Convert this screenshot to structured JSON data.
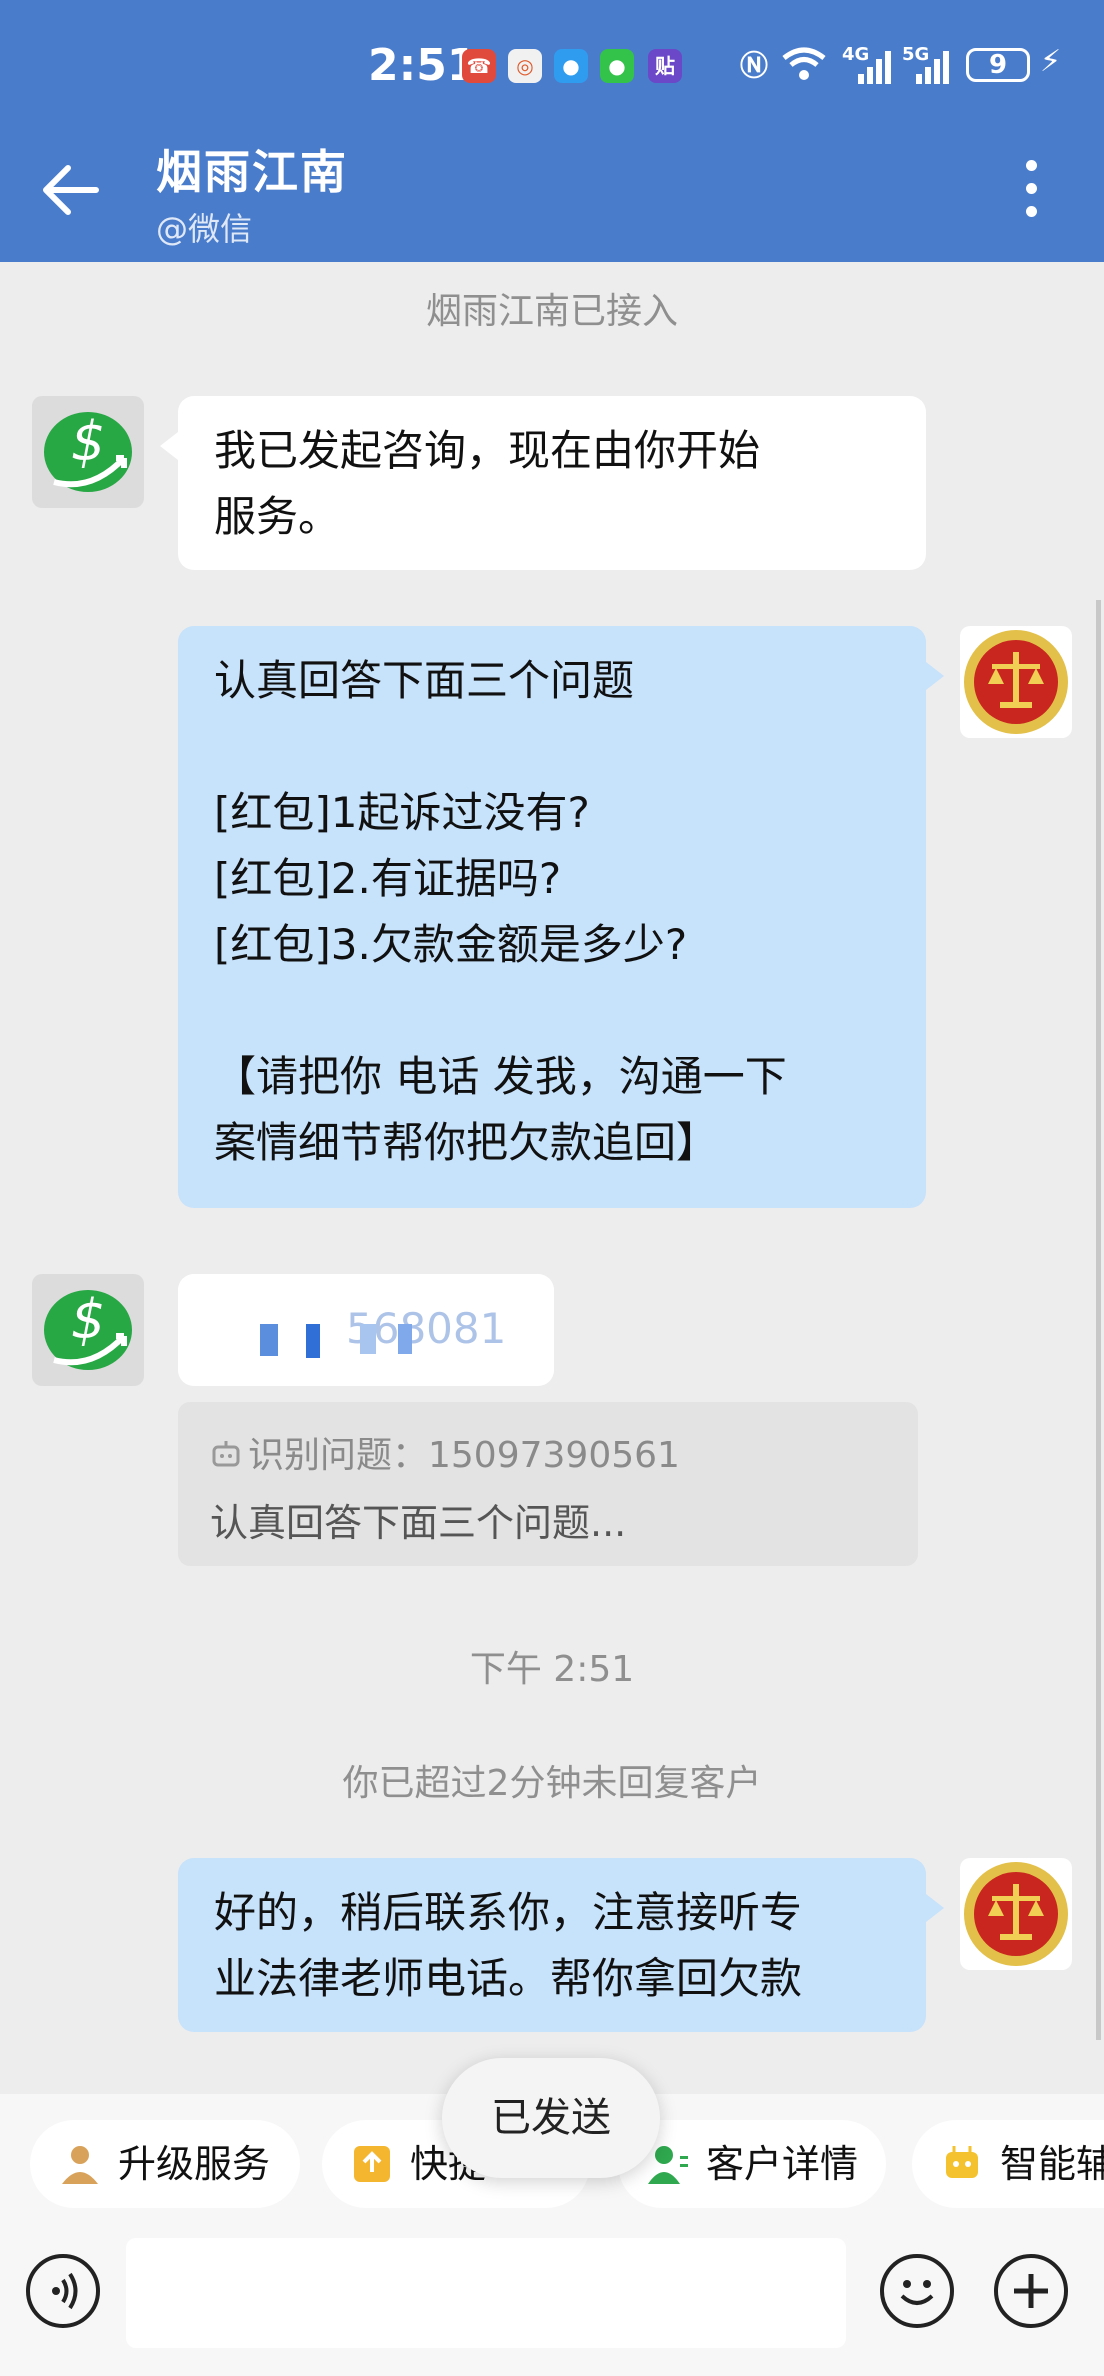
{
  "status_bar": {
    "time": "2:51",
    "battery": "9",
    "net1": "4G",
    "net2": "5G"
  },
  "header": {
    "title": "烟雨江南",
    "subtitle": "@微信"
  },
  "chat": {
    "system_joined": "烟雨江南已接入",
    "msg1": "我已发起咨询，现在由你开始\n服务。",
    "msg2": "认真回答下面三个问题\n\n[红包]1起诉过没有?\n[红包]2.有证据吗?\n[红包]3.欠款金额是多少?\n\n【请把你 电话 发我，沟通一下\n案情细节帮你把欠款追回】",
    "msg3_partial": "568081",
    "quote_label": "识别问题：15097390561",
    "quote_text": "认真回答下面三个问题...",
    "timestamp": "下午 2:51",
    "system_timeout": "你已超过2分钟未回复客户",
    "msg4": "好的，稍后联系你，注意接听专\n业法律老师电话。帮你拿回欠款"
  },
  "toast": "已发送",
  "quick_actions": [
    {
      "label": "升级服务",
      "icon": "person-upgrade-icon"
    },
    {
      "label": "快捷",
      "icon": "quick-reply-icon"
    },
    {
      "label": "客户详情",
      "icon": "customer-detail-icon"
    },
    {
      "label": "智能辅",
      "icon": "robot-icon"
    }
  ],
  "colors": {
    "header": "#4a7ccc",
    "bubble_out": "#c7e2fb",
    "bubble_in": "#ffffff"
  }
}
